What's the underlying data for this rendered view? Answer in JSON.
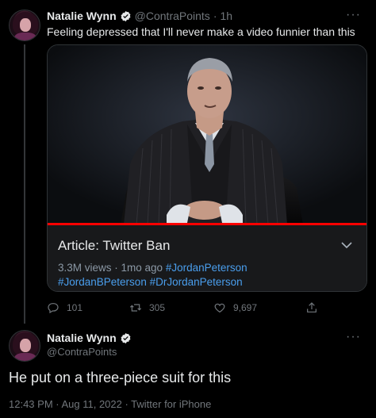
{
  "tweet1": {
    "author_name": "Natalie Wynn",
    "handle": "@ContraPoints",
    "separator": "·",
    "time": "1h",
    "more": "···",
    "text": "Feeling depressed that I'll never make a video funnier than this",
    "card": {
      "title": "Article: Twitter Ban",
      "meta_prefix": "3.3M views · 1mo ago",
      "hashtags": [
        "#JordanPeterson",
        "#JordanBPeterson",
        "#DrJordanPeterson"
      ]
    },
    "actions": {
      "replies": "101",
      "retweets": "305",
      "likes": "9,697"
    }
  },
  "tweet2": {
    "author_name": "Natalie Wynn",
    "handle": "@ContraPoints",
    "more": "···",
    "text": "He put on a three-piece suit for this",
    "timestamp": "12:43 PM · Aug 11, 2022 · Twitter for iPhone"
  },
  "colors": {
    "background": "#000000",
    "accent": "#4a9eed",
    "verified": "#1d9bf0",
    "muted": "#71767b",
    "progress": "#ff0000"
  },
  "icons": [
    "verified-badge-icon",
    "more-icon",
    "chevron-down-icon",
    "reply-icon",
    "retweet-icon",
    "like-icon",
    "share-icon"
  ]
}
